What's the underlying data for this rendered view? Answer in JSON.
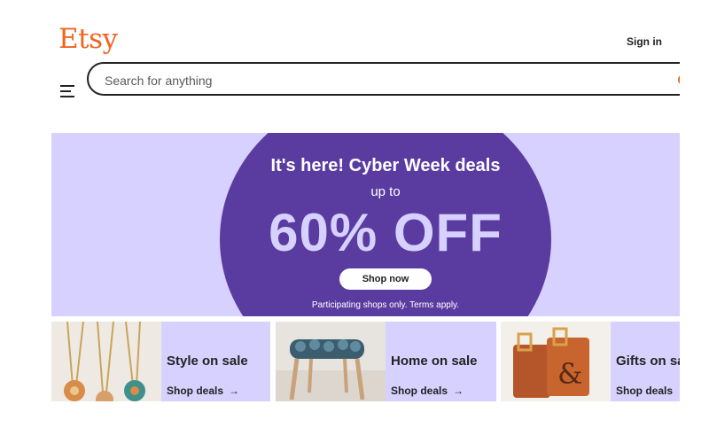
{
  "header": {
    "logo": "Etsy",
    "sign_in": "Sign in",
    "search_placeholder": "Search for anything"
  },
  "hero": {
    "title": "It's here! Cyber Week deals",
    "subtitle": "up to",
    "headline": "60% OFF",
    "button": "Shop now",
    "fine_print": "Participating shops only. Terms apply."
  },
  "cards": [
    {
      "label": "Style on sale",
      "link": "Shop deals",
      "arrow": "→"
    },
    {
      "label": "Home on sale",
      "link": "Shop deals",
      "arrow": "→"
    },
    {
      "label": "Gifts on sale",
      "link": "Shop deals",
      "arrow": "→"
    }
  ],
  "colors": {
    "brand": "#F1641E",
    "hero_bg": "#D7D1FF",
    "hero_circle": "#5A3CA1"
  },
  "icons": [
    "menu-icon",
    "arrow-right-icon"
  ]
}
